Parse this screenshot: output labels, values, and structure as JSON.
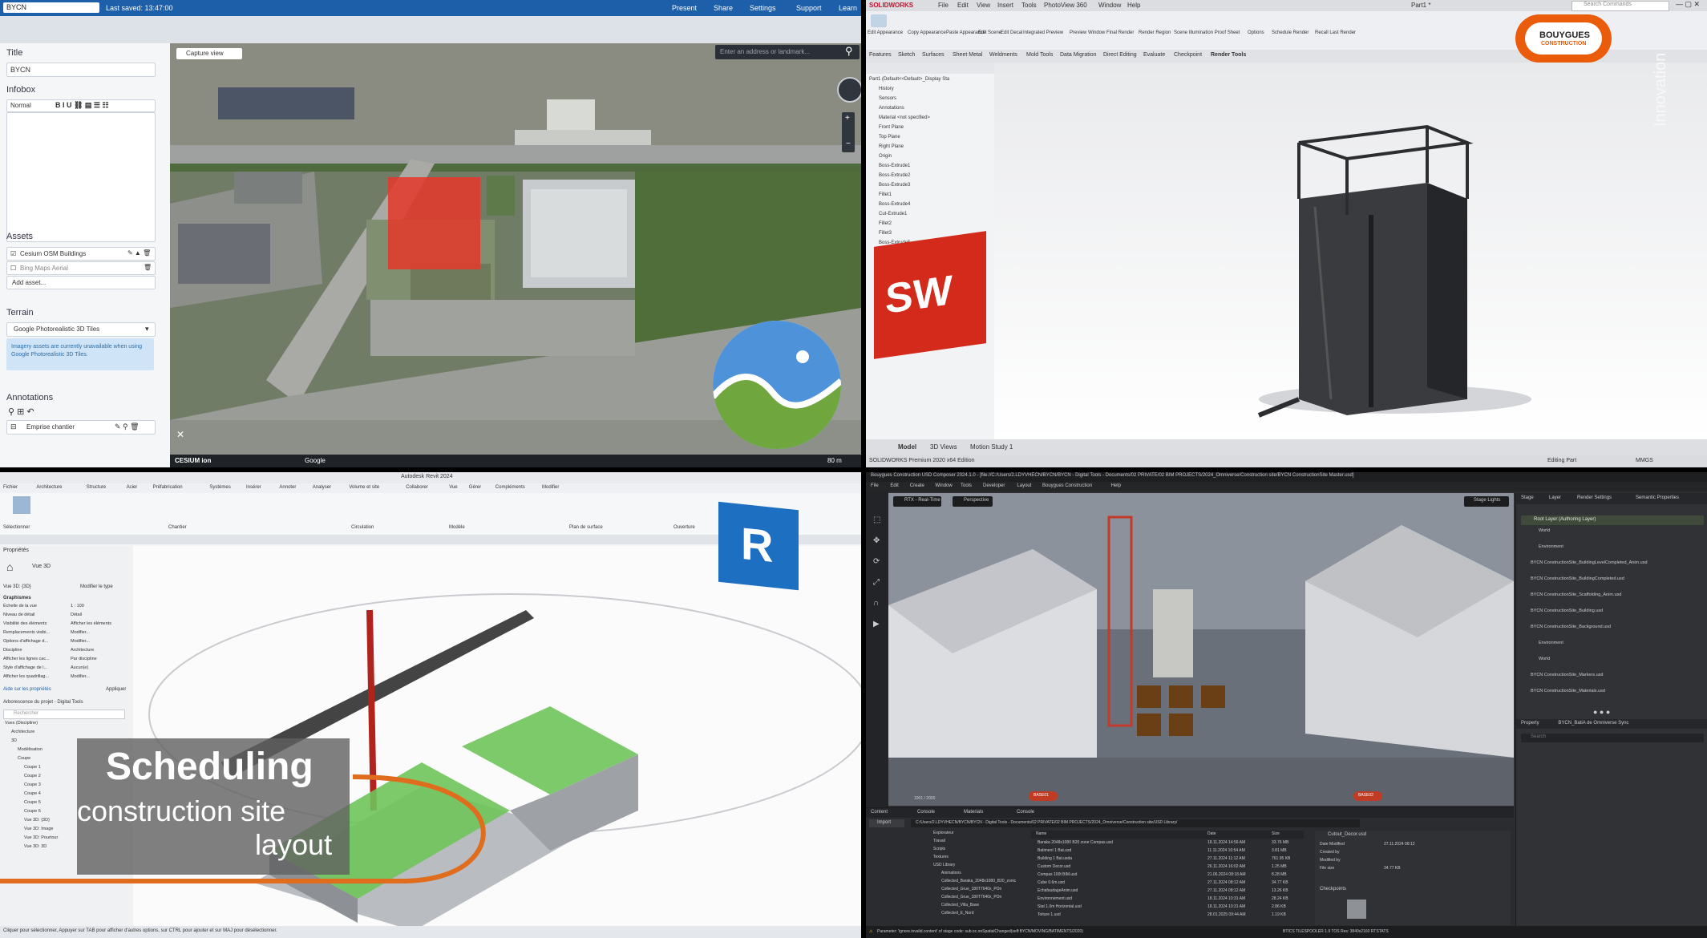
{
  "cesium": {
    "project_input": "BYCN",
    "last_saved": "Last saved: 13:47:00",
    "top_buttons": [
      "Present",
      "Share",
      "Settings",
      "Support",
      "Learn"
    ],
    "title_label": "Title",
    "title_value": "BYCN",
    "infobox_label": "Infobox",
    "infobox_format": "Normal",
    "assets_label": "Assets",
    "assets": [
      "Cesium OSM Buildings",
      "Bing Maps Aerial"
    ],
    "add_asset": "Add asset...",
    "terrain_label": "Terrain",
    "terrain_value": "Google Photorealistic 3D Tiles",
    "terrain_note": "Imagery assets are currently unavailable when using Google Photorealistic 3D Tiles.",
    "annotations_label": "Annotations",
    "annotation_item": "Emprise chantier",
    "capture_view": "Capture view",
    "search_placeholder": "Enter an address or landmark...",
    "footer_brand": "CESIUM ion",
    "footer_google": "Google",
    "footer_scale": "80 m"
  },
  "solidworks": {
    "app_logo": "SOLIDWORKS",
    "menu": [
      "File",
      "Edit",
      "View",
      "Insert",
      "Tools",
      "PhotoView 360",
      "Window",
      "Help"
    ],
    "doc_title": "Part1 *",
    "search_placeholder": "Search Commands",
    "ribbon_buttons": [
      "Edit Appearance",
      "Copy Appearance",
      "Paste Appearance",
      "Edit Scene",
      "Edit Decal",
      "Integrated Preview",
      "Preview Window",
      "Final Render",
      "Render Region",
      "Scene Illumination Proof Sheet",
      "Options",
      "Schedule Render",
      "Recall Last Render"
    ],
    "tabs": [
      "Features",
      "Sketch",
      "Surfaces",
      "Sheet Metal",
      "Weldments",
      "Mold Tools",
      "Data Migration",
      "Direct Editing",
      "Evaluate",
      "Checkpoint",
      "Render Tools"
    ],
    "tree": [
      "Part1 (Default<<Default>_Display Sta",
      "History",
      "Sensors",
      "Annotations",
      "Material <not specified>",
      "Front Plane",
      "Top Plane",
      "Right Plane",
      "Origin",
      "Boss-Extrude1",
      "Boss-Extrude2",
      "Boss-Extrude3",
      "Fillet1",
      "Boss-Extrude4",
      "Cut-Extrude1",
      "Fillet2",
      "Fillet3",
      "Boss-Extrude5",
      "Fillet4",
      "Cut-Extrude2"
    ],
    "bottom_tabs": [
      "Model",
      "3D Views",
      "Motion Study 1"
    ],
    "status_left": "SOLIDWORKS Premium 2020 x64 Edition",
    "status_right": "Editing Part",
    "status_units": "MMGS",
    "logo_letters": "SW",
    "brand_line1": "BOUYGUES",
    "brand_line2": "CONSTRUCTION",
    "innovation": "Innovation"
  },
  "revit": {
    "doc_title": "Autodesk Revit 2024",
    "menu": [
      "Fichier",
      "Architecture",
      "Structure",
      "Acier",
      "Préfabrication",
      "Systèmes",
      "Insérer",
      "Annoter",
      "Analyser",
      "Volume et site",
      "Collaborer",
      "Vue",
      "Gérer",
      "Compléments",
      "Modifier"
    ],
    "ribbon_groups": [
      "Sélectionner",
      "Chantier",
      "Circulation",
      "Modèle",
      "Plan de surface",
      "Ouverture"
    ],
    "props_header": "Propriétés",
    "view_type": "Vue 3D",
    "view_selector": "Vue 3D: {3D}",
    "edit_type": "Modifier le type",
    "graphics_label": "Graphismes",
    "props_rows": [
      [
        "Échelle de la vue",
        "1 : 100"
      ],
      [
        "Niveau de détail",
        "Détail"
      ],
      [
        "Visibilité des éléments",
        "Afficher les éléments"
      ],
      [
        "Remplacements visibi...",
        "Modifier..."
      ],
      [
        "Options d'affichage d...",
        "Modifier..."
      ],
      [
        "Discipline",
        "Architecture"
      ],
      [
        "Afficher les lignes cac...",
        "Par discipline"
      ],
      [
        "Style d'affichage de l...",
        "Aucun(e)"
      ],
      [
        "Afficher les quadrillag...",
        "Modifier..."
      ]
    ],
    "props_help": "Aide sur les propriétés",
    "apply": "Appliquer",
    "browser_header": "Arborescence du projet - Digital Tools",
    "browser_search": "Rechercher",
    "browser_items": [
      "Vues (Discipline)",
      "Architecture",
      "3D",
      "Modélisation",
      "Coupe",
      "Coupe 1",
      "Coupe 2",
      "Coupe 3",
      "Coupe 4",
      "Coupe 5",
      "Coupe 6",
      "Vue 3D: {3D}",
      "Vue 3D: Image",
      "Vue 3D: Pourtour",
      "Vue 3D: 3D"
    ],
    "status_text": "Cliquer pour sélectionner, Appuyer sur TAB pour afficher d'autres options, sur CTRL pour ajouter et sur MAJ pour désélectionner.",
    "logo_letter": "R",
    "overlay_title": "Scheduling",
    "overlay_line2": "construction site",
    "overlay_line3": "layout"
  },
  "omniverse": {
    "title": "Bouygues Construction USD Composer 2024.1.0 - [file://C:/Users/2.LDYVHECN/BYCN/BYCN - Digital Tools - Documents/02 PRIVATE/02 BIM PROJECTS/2024_Omniverse/Construction site/BYCN ConstructionSite Master.usd]",
    "menu": [
      "File",
      "Edit",
      "Create",
      "Window",
      "Tools",
      "Developer",
      "Layout",
      "Bouygues Construction",
      "Help"
    ],
    "rtx_mode": "RTX - Real-Time",
    "camera": "Perspective",
    "lights": "Stage Lights",
    "right_tabs": [
      "Stage",
      "Layer",
      "Render Settings",
      "Semantic Properties"
    ],
    "root_layer": "Root Layer (Authoring Layer)",
    "layers": [
      "World",
      "Environment",
      "BYCN ConstructionSite_BuildingLevelCompleted_Anim.usd",
      "BYCN ConstructionSite_BuildingCompleted.usd",
      "BYCN ConstructionSite_Scaffolding_Anim.usd",
      "BYCN ConstructionSite_Building.usd",
      "BYCN ConstructionSite_Background.usd",
      "Environment",
      "World",
      "BYCN ConstructionSite_Markers.usd",
      "BYCN ConstructionSite_Materials.usd"
    ],
    "property_tabs": [
      "Property",
      "BYCN_BatiA de Omniverse Sync"
    ],
    "search": "Search",
    "bottom_tabs": [
      "Content",
      "Console",
      "Materials",
      "Console"
    ],
    "import_btn": "Import",
    "path": "C:/Users/2.LDYVHECN/BYCN/BYCN - Digital Tools - Documents/02 PRIVATE/02 BIM PROJECTS/2024_Omniverse/Construction site/USD Library/",
    "folder_tree": [
      "Explorateur",
      "Travail",
      "Scripts",
      "Textures",
      "USD Library",
      "Animations",
      "Collected_Baraka_2048x1080_B20_zonic",
      "Collected_Grue_180T7640x_POn",
      "Collected_Grue_180T7640x_POn",
      "Collected_Villa_Base",
      "Collected_E_Nord"
    ],
    "file_header": [
      "Name",
      "Date",
      "Size"
    ],
    "files": [
      [
        "Baraka 2048x1080 B20 zone Compas.usd",
        "18.11.2024 14:56 AM",
        "33.76 MB"
      ],
      [
        "Batiment 1 Bat.usd",
        "11.11.2024 10:54 AM",
        "3.81 MB"
      ],
      [
        "Building 1 Bat.usda",
        "27.11.2024 11:12 AM",
        "761.95 KB"
      ],
      [
        "Custom Decor.usd",
        "26.11.2024 16:02 AM",
        "1.25 MB"
      ],
      [
        "Compas 100t BIM.usd",
        "21.06.2024 08:18 AM",
        "8.28 MB"
      ],
      [
        "Cube 0.6m.usd",
        "27.11.2024 08:12 AM",
        "34.77 KB"
      ],
      [
        "EchafaudageAnim.usd",
        "27.11.2024 08:12 AM",
        "13.26 KB"
      ],
      [
        "Environnement.usd",
        "18.11.2024 10:31 AM",
        "28.24 KB"
      ],
      [
        "Stat 1.0m Horizontal.usd",
        "18.11.2024 10:31 AM",
        "2.86 KB"
      ],
      [
        "Toiture 1.usd",
        "28.01.2025 09:44 AM",
        "1.19 KB"
      ]
    ],
    "detail_file": "Cutout_Decor.usd",
    "detail_rows": [
      [
        "Date Modified",
        "27.11.2024 08:12"
      ],
      [
        "Created by",
        ""
      ],
      [
        "Modified by",
        ""
      ],
      [
        "File size",
        "34.77 KB"
      ]
    ],
    "checkpoints": "Checkpoints",
    "status": "Parameter: 'ignore.invalid.content' of stage code: sub.oc.onSpatialChanged(self:BYCN/MOVING/BATIMENTS/2020)",
    "status_right": "BTICS  TILESPOOLER  1.9 TOS  Res: 3840x2160  RTSTATS",
    "vp_labels": [
      "BASE01",
      "BASE02"
    ],
    "vp_corner": "1001 / 2000"
  }
}
